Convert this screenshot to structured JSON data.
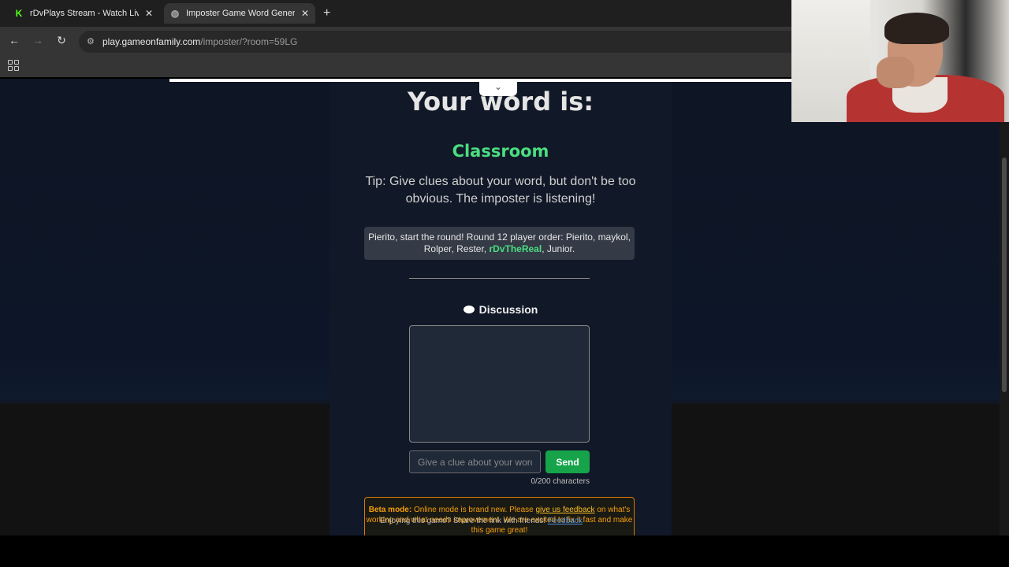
{
  "browser": {
    "tabs": [
      {
        "title": "rDvPlays Stream - Watch Live o",
        "active": false,
        "favicon": "kick-icon"
      },
      {
        "title": "Imposter Game Word Generato",
        "active": true,
        "favicon": "globe-icon"
      }
    ],
    "new_tab": "+",
    "url_host": "play.gameonfamily.com",
    "url_path": "/imposter/?room=59LG"
  },
  "game": {
    "heading": "Your word is:",
    "word": "Classroom",
    "tip": "Tip: Give clues about your word, but don't be too obvious. The imposter is listening!",
    "order_prefix": "Pierito, start the round! Round 12 player order: Pierito, maykol, Rolper, Rester, ",
    "order_highlight": "rDvTheReal",
    "order_suffix": ", Junior.",
    "discussion_title": "Discussion",
    "clue_placeholder": "Give a clue about your word",
    "send_label": "Send",
    "char_count": "0/200 characters",
    "beta_label": "Beta mode:",
    "beta_text_1": " Online mode is brand new. Please ",
    "beta_link": "give us feedback",
    "beta_text_2": " on what's working and what needs improvement. We are excited to fix it fast and make this game great!",
    "enjoy_text": "Enjoying this game? Share the link with friends!",
    "enjoy_link": "Feedback"
  },
  "colors": {
    "accent_green": "#4ade80",
    "send_button": "#16a34a",
    "beta_border": "#d97706"
  }
}
